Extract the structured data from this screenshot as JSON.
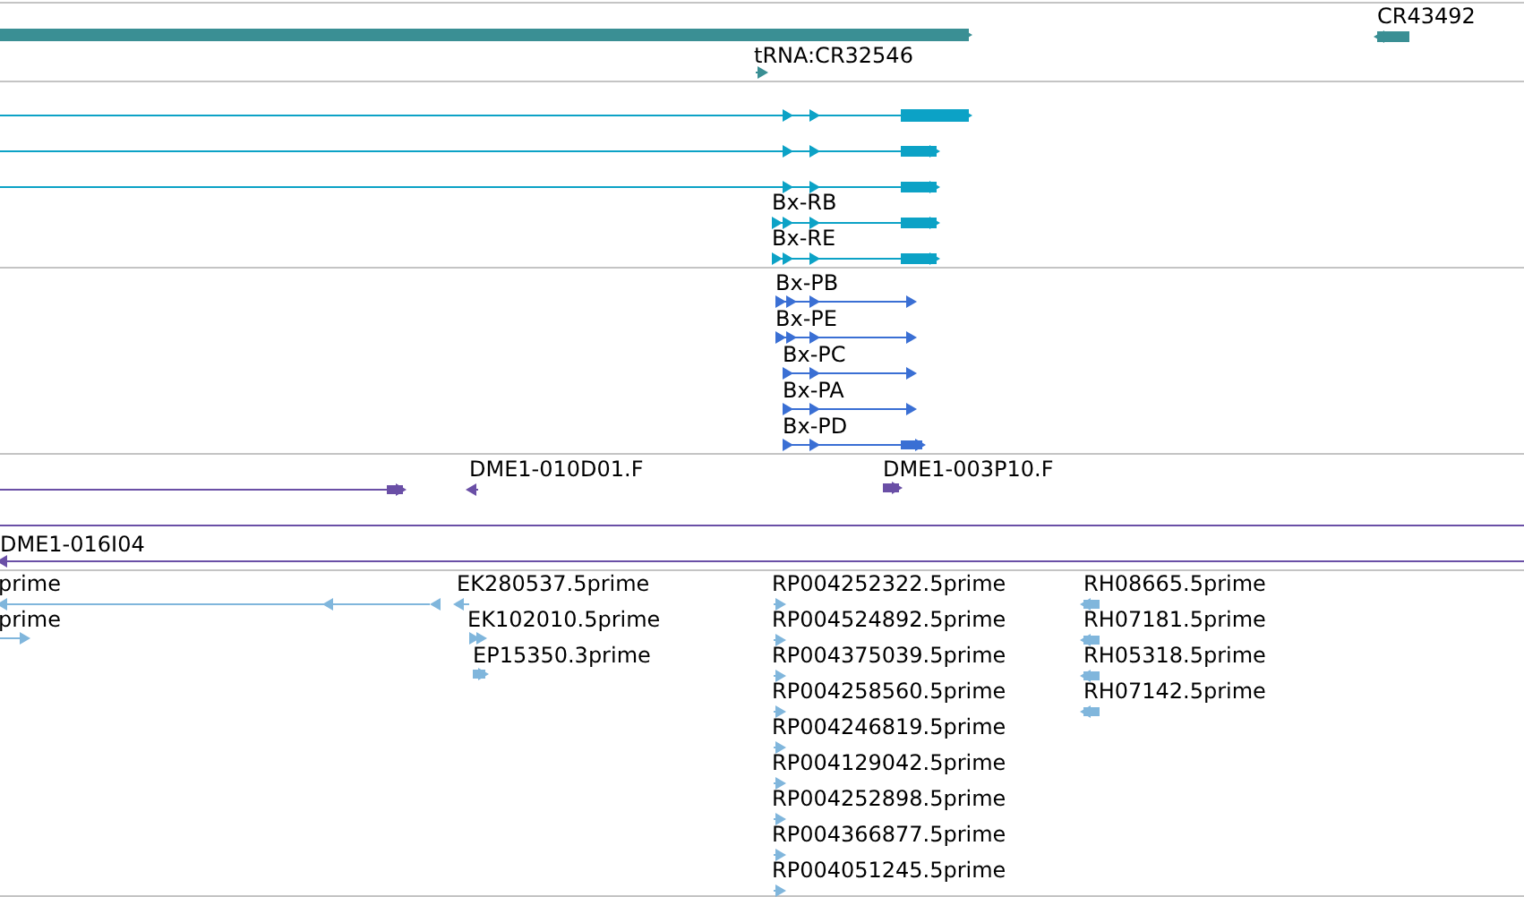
{
  "tracks": [
    {
      "features": [
        {
          "reverse": false
        },
        {
          "label": "tRNA:CR32546",
          "reverse": false
        },
        {
          "label": "CR43492",
          "reverse": true
        }
      ]
    },
    {
      "features": [
        {
          "reverse": false
        },
        {
          "reverse": false
        },
        {
          "reverse": false
        },
        {
          "label": "Bx-RB",
          "reverse": false
        },
        {
          "label": "Bx-RE",
          "reverse": false
        }
      ]
    },
    {
      "features": [
        {
          "label": "Bx-PB",
          "reverse": false
        },
        {
          "label": "Bx-PE",
          "reverse": false
        },
        {
          "label": "Bx-PC",
          "reverse": false
        },
        {
          "label": "Bx-PA",
          "reverse": false
        },
        {
          "label": "Bx-PD",
          "reverse": false
        }
      ]
    },
    {
      "features": [
        {
          "reverse": false
        },
        {
          "label": "DME1-010D01.F",
          "reverse": true
        },
        {
          "label": "DME1-003P10.F",
          "reverse": false
        },
        {
          "reverse": false
        },
        {
          "label": "DME1-016I04",
          "reverse": true
        }
      ]
    },
    {
      "features": [
        {
          "label": "prime",
          "reverse": true
        },
        {
          "label": "prime",
          "reverse": false
        },
        {
          "label": "EK280537.5prime",
          "reverse": true
        },
        {
          "label": "EK102010.5prime",
          "reverse": false
        },
        {
          "label": "EP15350.3prime",
          "reverse": false
        },
        {
          "label": "RP004252322.5prime",
          "reverse": false
        },
        {
          "label": "RP004524892.5prime",
          "reverse": false
        },
        {
          "label": "RP004375039.5prime",
          "reverse": false
        },
        {
          "label": "RP004258560.5prime",
          "reverse": false
        },
        {
          "label": "RP004246819.5prime",
          "reverse": false
        },
        {
          "label": "RP004129042.5prime",
          "reverse": false
        },
        {
          "label": "RP004252898.5prime",
          "reverse": false
        },
        {
          "label": "RP004366877.5prime",
          "reverse": false
        },
        {
          "label": "RP004051245.5prime",
          "reverse": false
        },
        {
          "label": "RH08665.5prime",
          "reverse": true
        },
        {
          "label": "RH07181.5prime",
          "reverse": true
        },
        {
          "label": "RH05318.5prime",
          "reverse": true
        },
        {
          "label": "RH07142.5prime",
          "reverse": true
        }
      ]
    }
  ]
}
